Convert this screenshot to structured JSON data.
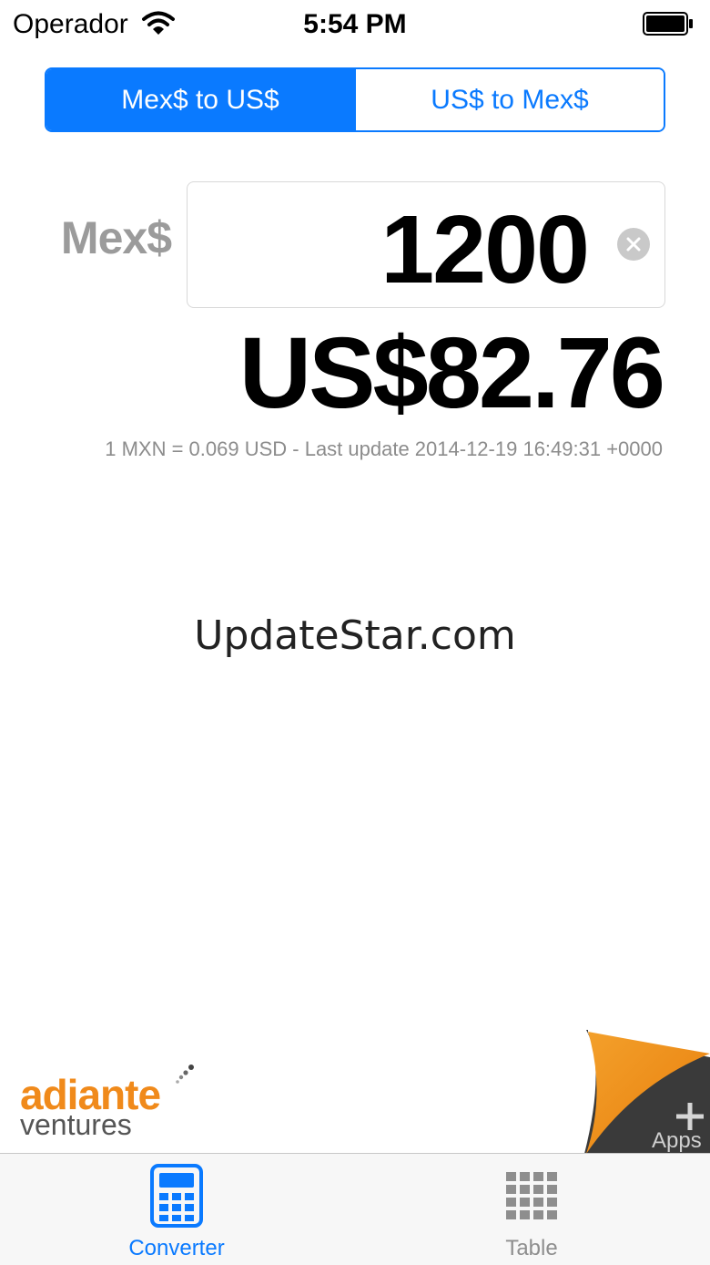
{
  "status_bar": {
    "carrier": "Operador",
    "time": "5:54 PM"
  },
  "segmented": {
    "options": [
      {
        "label": "Mex$ to US$",
        "selected": true
      },
      {
        "label": "US$ to Mex$",
        "selected": false
      }
    ]
  },
  "converter": {
    "input_currency_label": "Mex$",
    "input_value": "1200",
    "result": "US$82.76",
    "rate_info": "1 MXN = 0.069 USD - Last update 2014-12-19 16:49:31 +0000"
  },
  "watermark": "UpdateStar.com",
  "ad": {
    "brand": "adiante",
    "sub": "ventures",
    "apps_label": "Apps"
  },
  "tabs": [
    {
      "label": "Converter",
      "selected": true
    },
    {
      "label": "Table",
      "selected": false
    }
  ],
  "colors": {
    "accent": "#0a7aff",
    "ad_orange": "#f08a1b",
    "muted": "#8e8e8e"
  }
}
